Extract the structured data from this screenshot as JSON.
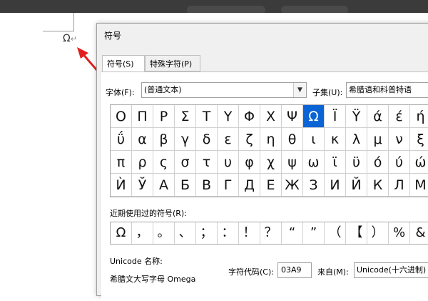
{
  "document": {
    "inserted_char": "Ω",
    "return_mark": "↵"
  },
  "dialog": {
    "title": "符号",
    "tabs": [
      {
        "label": "符号(S)"
      },
      {
        "label": "特殊字符(P)"
      }
    ],
    "font": {
      "label": "字体(F):",
      "value": "(普通文本)"
    },
    "subset": {
      "label": "子集(U):",
      "value": "希腊语和科普特语"
    },
    "grid": {
      "rows": [
        [
          "Ο",
          "Π",
          "Ρ",
          "Σ",
          "Τ",
          "Υ",
          "Φ",
          "Χ",
          "Ψ",
          "Ω",
          "Ϊ",
          "Ϋ",
          "ά",
          "έ",
          "ή"
        ],
        [
          "ΰ",
          "α",
          "β",
          "γ",
          "δ",
          "ε",
          "ζ",
          "η",
          "θ",
          "ι",
          "κ",
          "λ",
          "μ",
          "ν",
          "ξ"
        ],
        [
          "π",
          "ρ",
          "ς",
          "σ",
          "τ",
          "υ",
          "φ",
          "χ",
          "ψ",
          "ω",
          "ϊ",
          "ϋ",
          "ό",
          "ύ",
          "ώ"
        ],
        [
          "Ѝ",
          "Ў",
          "А",
          "Б",
          "В",
          "Г",
          "Д",
          "Е",
          "Ж",
          "З",
          "И",
          "Й",
          "К",
          "Л",
          "М"
        ]
      ],
      "selected": "Ω"
    },
    "recent": {
      "label": "近期使用过的符号(R):",
      "items": [
        "Ω",
        "，",
        "。",
        "、",
        "；",
        "：",
        "！",
        "？",
        "“",
        "”",
        "（",
        "【",
        "）",
        "%",
        "&"
      ]
    },
    "unicode_name_label": "Unicode 名称:",
    "unicode_name_value": "希腊文大写字母 Omega",
    "char_code": {
      "label": "字符代码(C):",
      "value": "03A9"
    },
    "from": {
      "label": "来自(M):",
      "value": "Unicode(十六进制)"
    }
  },
  "colors": {
    "selection": "#0a64d6",
    "arrow": "#e02020",
    "topbar": "#3b3b3b"
  },
  "icons": {
    "dropdown": "chevron-down-icon",
    "arrow": "red-arrow-annotation"
  }
}
